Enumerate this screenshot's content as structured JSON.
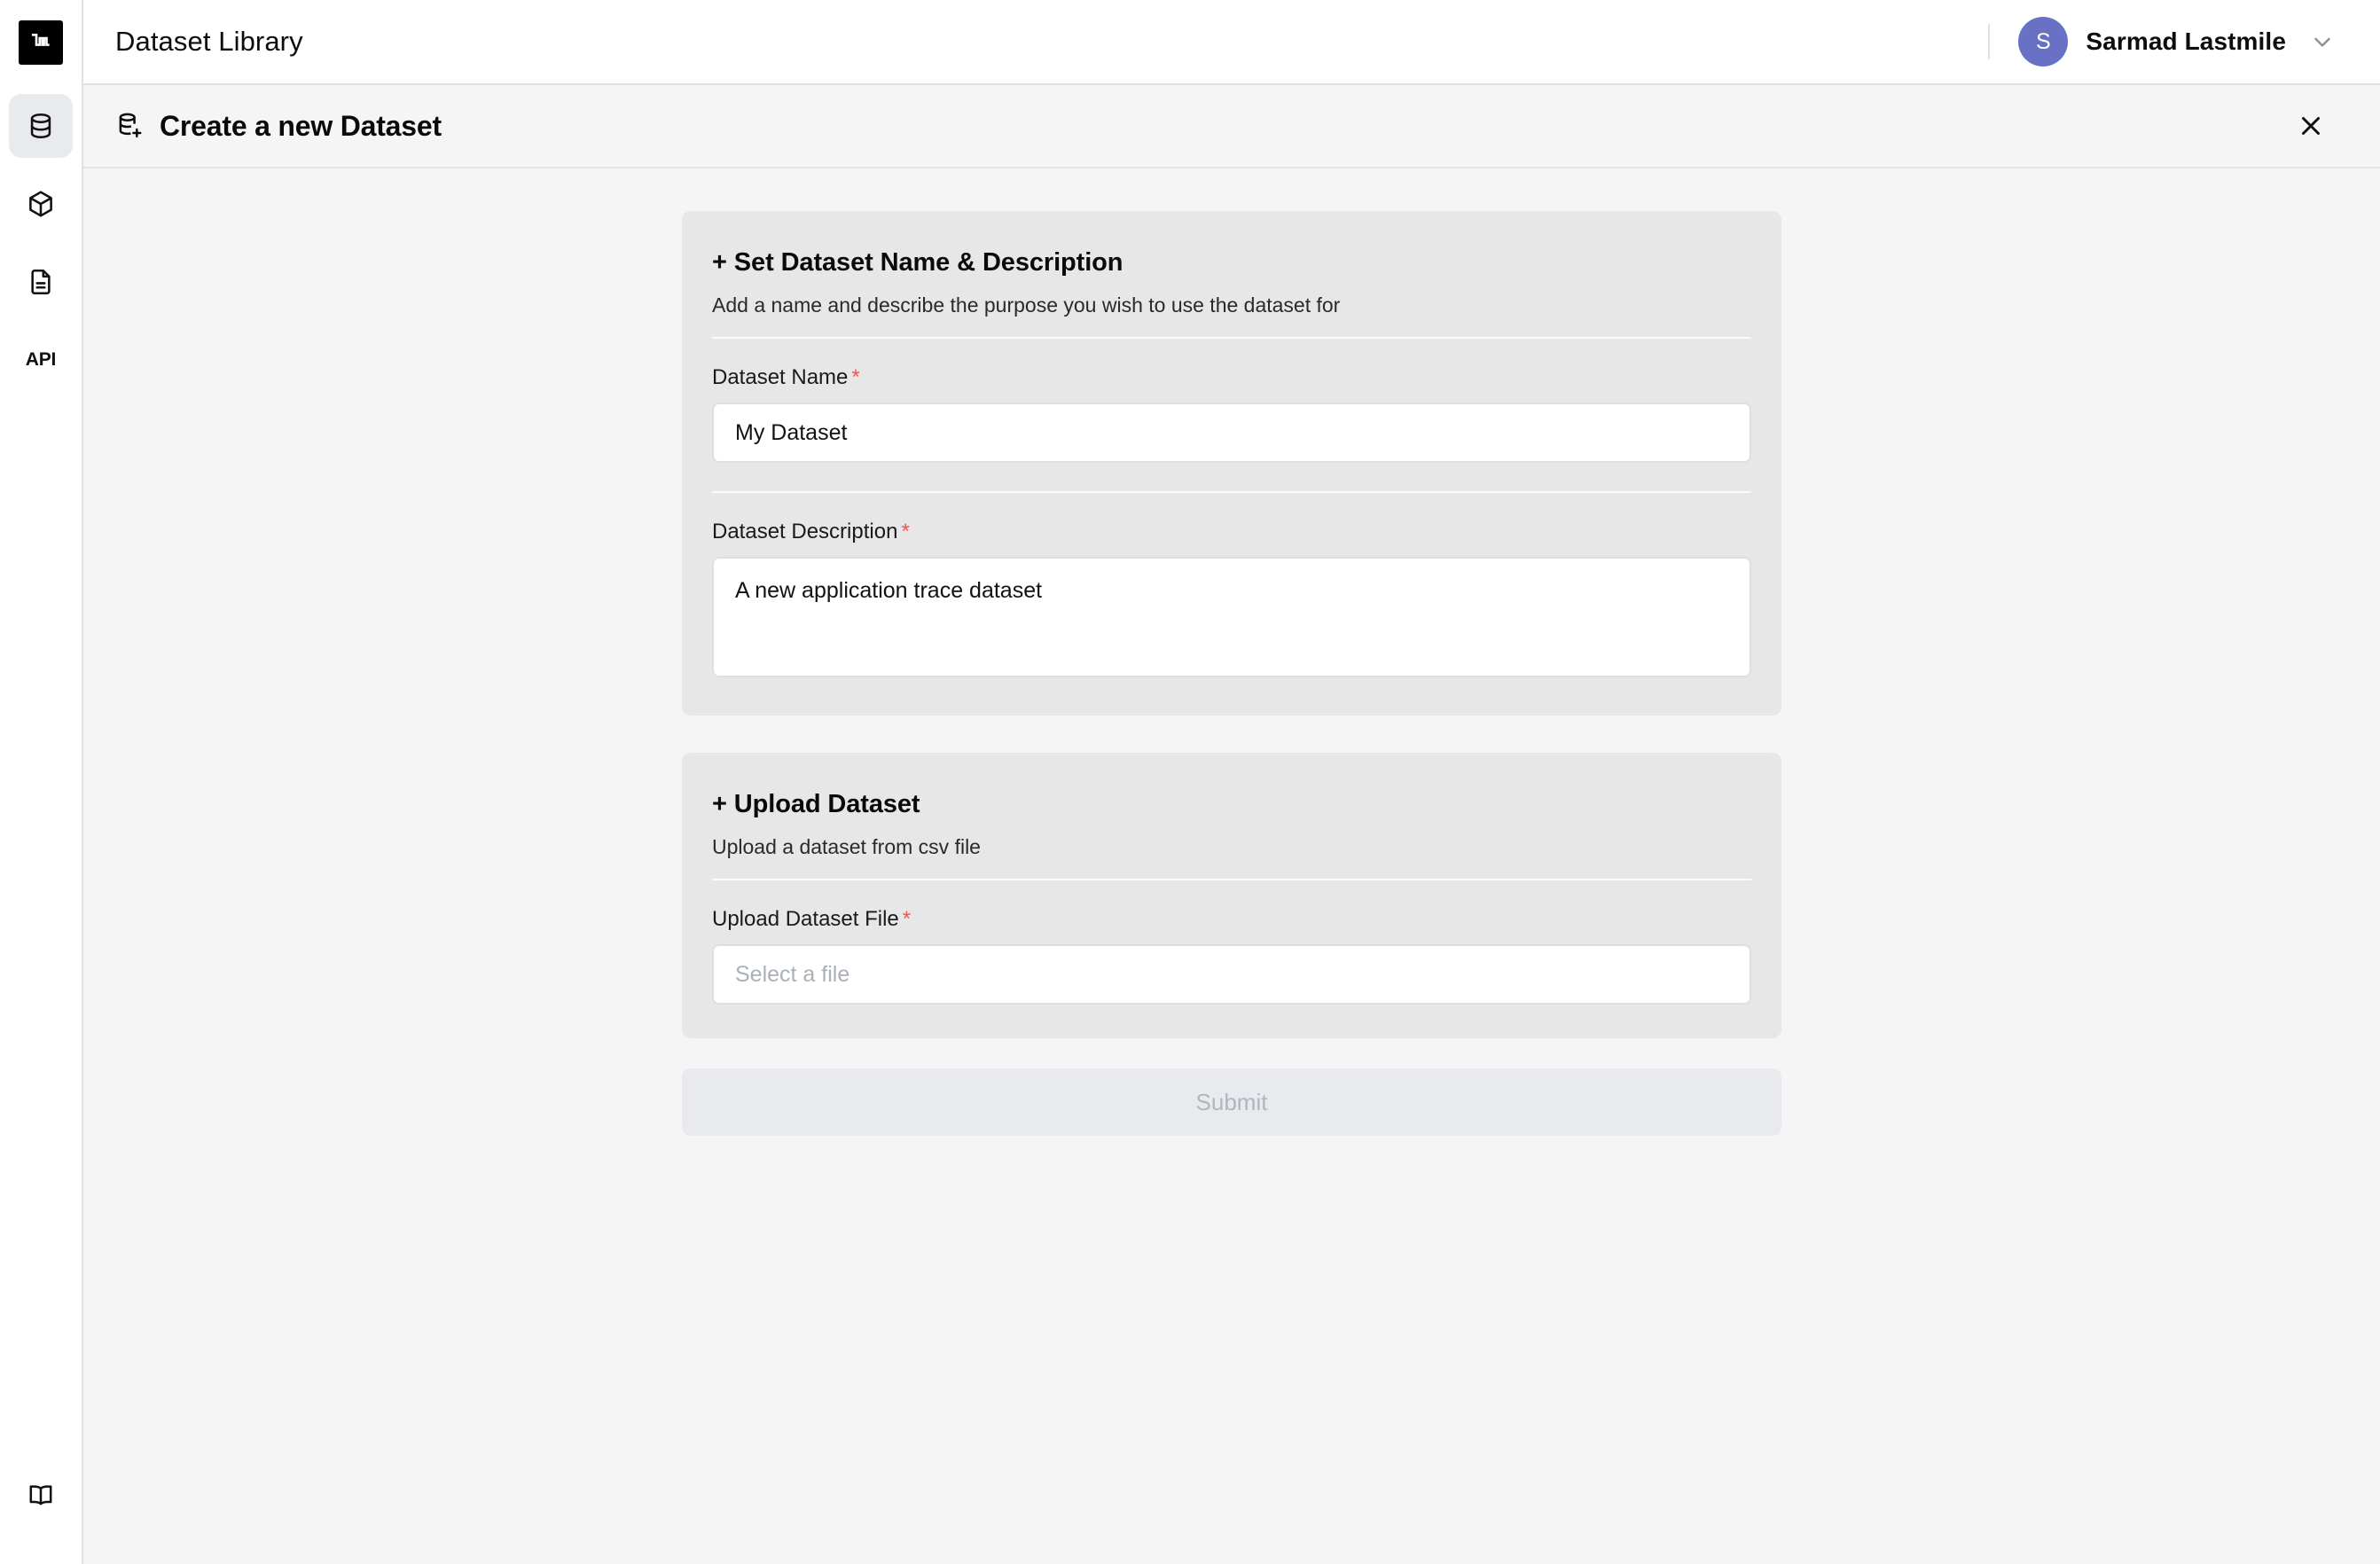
{
  "brand": {
    "logo_text": "lm",
    "logo_bg": "#000000"
  },
  "sidebar": {
    "items": [
      {
        "label": "Datasets",
        "icon": "database-icon",
        "active": true
      },
      {
        "label": "Models",
        "icon": "cube-icon",
        "active": false
      },
      {
        "label": "Documents",
        "icon": "document-icon",
        "active": false
      },
      {
        "label": "API",
        "icon": "api-text",
        "active": false
      }
    ],
    "bottom_item": {
      "label": "Docs",
      "icon": "book-icon"
    },
    "active_bg": "#e9eaee"
  },
  "topbar": {
    "title": "Dataset Library",
    "user": {
      "name": "Sarmad Lastmile",
      "initial": "S",
      "avatar_color": "#6971c4"
    },
    "caret_icon": "chevron-down-icon"
  },
  "page_header": {
    "icon": "database-plus-icon",
    "title": "Create a new Dataset",
    "close_icon": "close-icon"
  },
  "cards": [
    {
      "title": "+ Set Dataset Name & Description",
      "subtitle": "Add a name and describe the purpose you wish to use the dataset for",
      "fields": [
        {
          "label": "Dataset Name",
          "required": true,
          "required_mark": "*",
          "type": "input",
          "value": "My Dataset",
          "placeholder": ""
        },
        {
          "label": "Dataset Description",
          "required": true,
          "required_mark": "*",
          "type": "textarea",
          "value": "A new application trace dataset",
          "placeholder": ""
        }
      ]
    },
    {
      "title": "+ Upload Dataset",
      "subtitle": "Upload a dataset from csv file",
      "fields": [
        {
          "label": "Upload Dataset File",
          "required": true,
          "required_mark": "*",
          "type": "input",
          "value": "",
          "placeholder": "Select a file"
        }
      ]
    }
  ],
  "submit": {
    "label": "Submit",
    "disabled": true,
    "bg": "#e9eaee",
    "text_color": "#b0b5bf"
  },
  "colors": {
    "page_bg": "#f5f5f5",
    "card_bg": "#e7e7e8",
    "required_red": "#f0564e",
    "border": "#dfe1e6"
  }
}
